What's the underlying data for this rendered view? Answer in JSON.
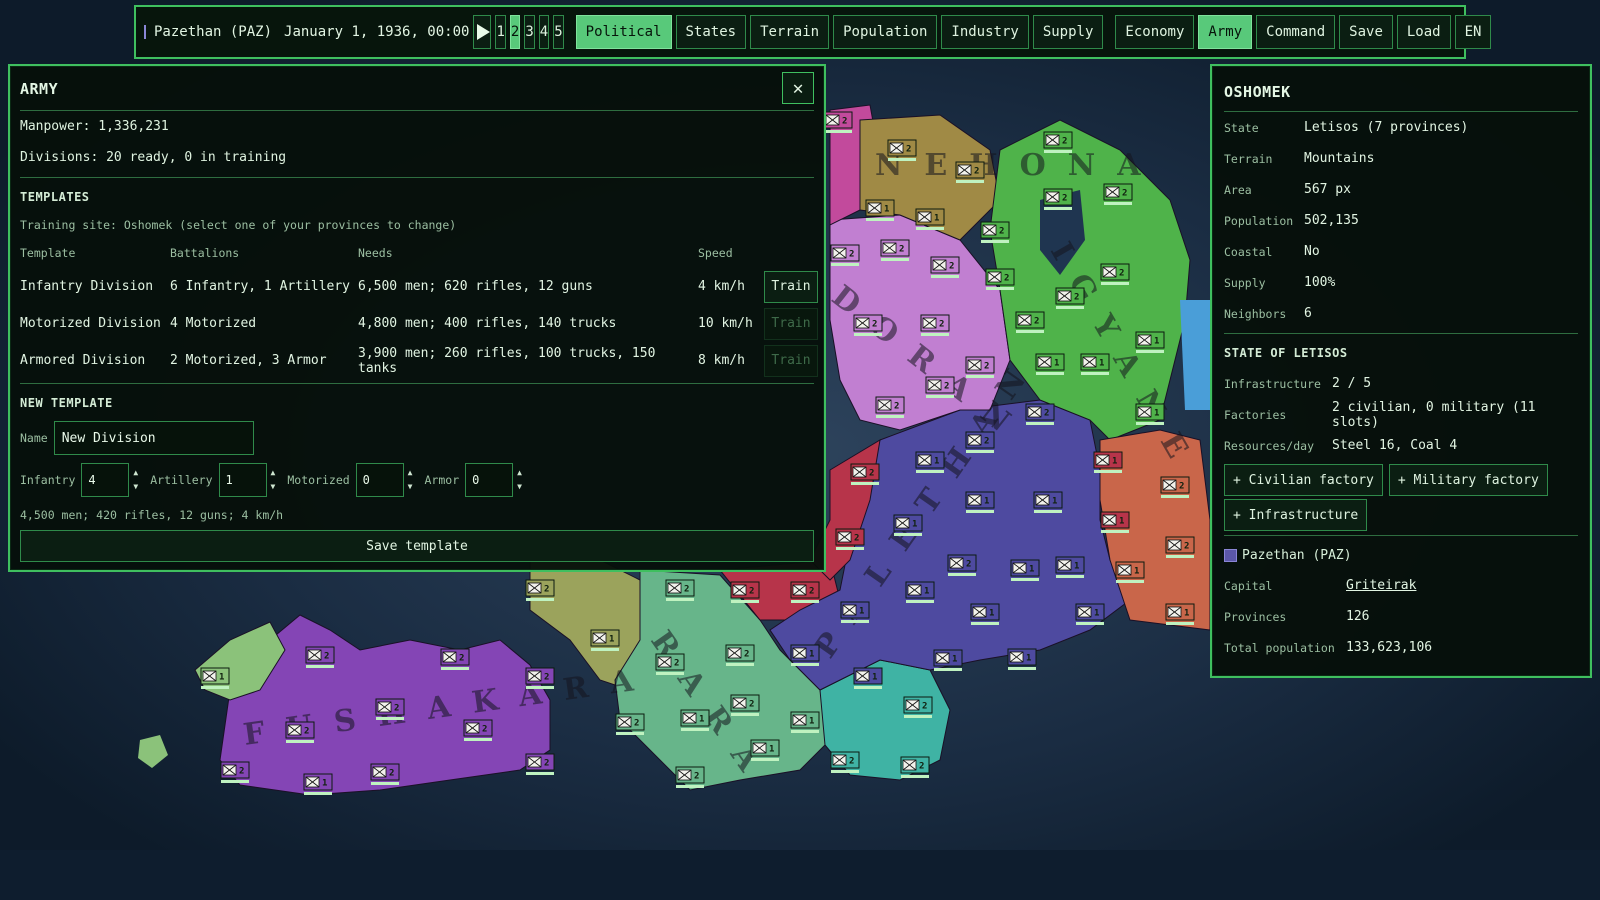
{
  "topbar": {
    "country": "Pazethan (PAZ)",
    "country_color": "#5b57a8",
    "date": "January 1, 1936, 00:00",
    "play_icon": "play-icon",
    "speeds": [
      "1",
      "2",
      "3",
      "4",
      "5"
    ],
    "active_speed": "2",
    "modes": [
      "Political",
      "States",
      "Terrain",
      "Population",
      "Industry",
      "Supply"
    ],
    "active_mode": "Political",
    "panels": [
      "Economy",
      "Army",
      "Command"
    ],
    "active_panel": "Army",
    "actions": [
      "Save",
      "Load",
      "EN"
    ]
  },
  "army": {
    "title": "ARMY",
    "close_icon": "close-icon",
    "manpower": "Manpower: 1,336,231",
    "divisions": "Divisions: 20 ready, 0 in training",
    "templates_heading": "TEMPLATES",
    "training_site": "Training site: Oshomek (select one of your provinces to change)",
    "columns": [
      "Template",
      "Battalions",
      "Needs",
      "Speed"
    ],
    "templates": [
      {
        "name": "Infantry Division",
        "battalions": "6 Infantry, 1 Artillery",
        "needs": "6,500 men; 620 rifles, 12 guns",
        "speed": "4 km/h",
        "train": "Train",
        "enabled": true
      },
      {
        "name": "Motorized Division",
        "battalions": "4 Motorized",
        "needs": "4,800 men; 400 rifles, 140 trucks",
        "speed": "10 km/h",
        "train": "Train",
        "enabled": false
      },
      {
        "name": "Armored Division",
        "battalions": "2 Motorized, 3 Armor",
        "needs": "3,900 men; 260 rifles, 100 trucks, 150 tanks",
        "speed": "8 km/h",
        "train": "Train",
        "enabled": false
      }
    ],
    "new_template": {
      "heading": "NEW TEMPLATE",
      "name_label": "Name",
      "name_value": "New Division",
      "infantry_label": "Infantry",
      "infantry_value": "4",
      "artillery_label": "Artillery",
      "artillery_value": "1",
      "motorized_label": "Motorized",
      "motorized_value": "0",
      "armor_label": "Armor",
      "armor_value": "0",
      "summary": "4,500 men; 420 rifles, 12 guns; 4 km/h",
      "save_label": "Save template"
    }
  },
  "province": {
    "title": "OSHOMEK",
    "state_label": "State",
    "state_value": "Letisos (7 provinces)",
    "terrain_label": "Terrain",
    "terrain_value": "Mountains",
    "area_label": "Area",
    "area_value": "567 px",
    "population_label": "Population",
    "population_value": "502,135",
    "coastal_label": "Coastal",
    "coastal_value": "No",
    "supply_label": "Supply",
    "supply_value": "100%",
    "neighbors_label": "Neighbors",
    "neighbors_value": "6",
    "state_heading": "STATE OF LETISOS",
    "infrastructure_label": "Infrastructure",
    "infrastructure_value": "2 / 5",
    "factories_label": "Factories",
    "factories_value": "2 civilian, 0 military (11 slots)",
    "resources_label": "Resources/day",
    "resources_value": "Steel 16, Coal 4",
    "civilian_btn": "+ Civilian factory",
    "military_btn": "+ Military factory",
    "infra_btn": "+ Infrastructure",
    "owner_name": "Pazethan (PAZ)",
    "owner_color": "#5b57a8",
    "capital_label": "Capital",
    "capital_value": "Griteirak",
    "provinces_label": "Provinces",
    "provinces_value": "126",
    "total_pop_label": "Total population",
    "total_pop_value": "133,623,106"
  },
  "map": {
    "labels": [
      "NEHONA",
      "IGYANE",
      "DORAN",
      "FUSHAKARA",
      "PALETHAN",
      "RARA"
    ],
    "country_colors": {
      "pazethan": "#4e4aa0",
      "green": "#4fb34a",
      "pink": "#c24a9c",
      "violet": "#c17fd1",
      "gold": "#a08a45",
      "red": "#b7344a",
      "mint": "#67b58a",
      "teal": "#3fb3a4",
      "olive": "#9ba35c",
      "orange": "#c9664a",
      "purple": "#8445b5",
      "lightgreen": "#8bc27a",
      "sky": "#4a9ed8"
    }
  }
}
